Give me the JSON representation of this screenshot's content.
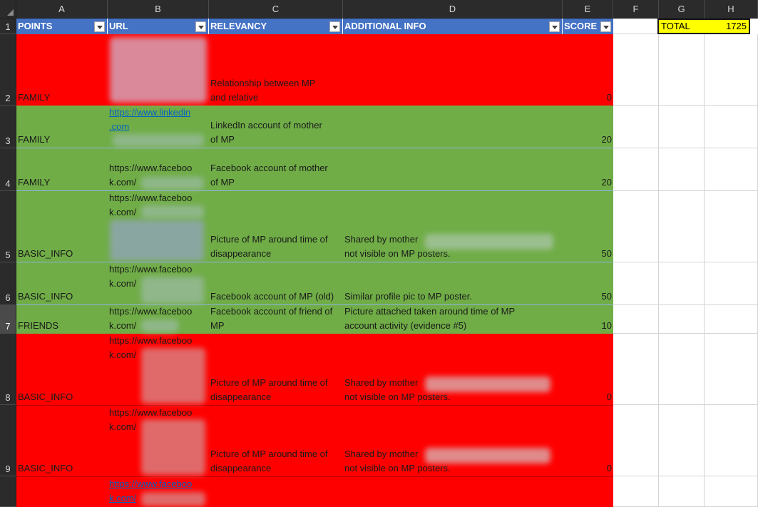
{
  "columns": [
    "A",
    "B",
    "C",
    "D",
    "E",
    "F",
    "G",
    "H"
  ],
  "rows": [
    "1",
    "2",
    "3",
    "4",
    "5",
    "6",
    "7",
    "8",
    "9"
  ],
  "headers": {
    "points": "POINTS",
    "url": "URL",
    "relevancy": "RELEVANCY",
    "additional_info": "ADDITIONAL INFO",
    "score": "SCORE"
  },
  "total": {
    "label": "TOTAL",
    "value": "1725"
  },
  "colors": {
    "found": "#70ad47",
    "not_found": "#ff0000",
    "header": "#4472c4",
    "total": "#ffff00"
  },
  "data": [
    {
      "row": "2",
      "points": "FAMILY",
      "url": "",
      "relevancy": "Relationship between MP\nand relative",
      "info": "",
      "score": "0",
      "status": "red"
    },
    {
      "row": "3",
      "points": "FAMILY",
      "url": "https://www.linkedin\n.com",
      "relevancy": "LinkedIn account of mother\nof MP",
      "info": "",
      "score": "20",
      "status": "green"
    },
    {
      "row": "4",
      "points": "FAMILY",
      "url": "https://www.faceboo\nk.com/",
      "relevancy": "Facebook account of mother\nof MP",
      "info": "",
      "score": "20",
      "status": "green"
    },
    {
      "row": "5",
      "points": "BASIC_INFO",
      "url": "https://www.faceboo\nk.com/",
      "relevancy": "Picture of MP around time of\ndisappearance",
      "info": "Shared by mother\nnot visible on MP posters.",
      "score": "50",
      "status": "green"
    },
    {
      "row": "6",
      "points": "BASIC_INFO",
      "url": "https://www.faceboo\nk.com/",
      "relevancy": "Facebook account of MP (old)",
      "info": "Similar profile pic to MP poster.",
      "score": "50",
      "status": "green"
    },
    {
      "row": "7",
      "points": "FRIENDS",
      "url": "https://www.faceboo\nk.com/",
      "relevancy": "Facebook account of friend of\nMP",
      "info": "Picture attached taken around time of MP\naccount activity (evidence #5)",
      "score": "10",
      "status": "green"
    },
    {
      "row": "8",
      "points": "BASIC_INFO",
      "url": "https://www.faceboo\nk.com/",
      "relevancy": "Picture of MP around time of\ndisappearance",
      "info": "Shared by mother\nnot visible on MP posters.",
      "score": "0",
      "status": "red"
    },
    {
      "row": "9",
      "points": "BASIC_INFO",
      "url": "https://www.faceboo\nk.com/",
      "relevancy": "Picture of MP around time of\ndisappearance",
      "info": "Shared by mother\nnot visible on MP posters.",
      "score": "0",
      "status": "red"
    },
    {
      "row": "",
      "points": "",
      "url": "https://www.faceboo\nk.com/",
      "relevancy": "",
      "info": "",
      "score": "",
      "status": "red"
    }
  ]
}
